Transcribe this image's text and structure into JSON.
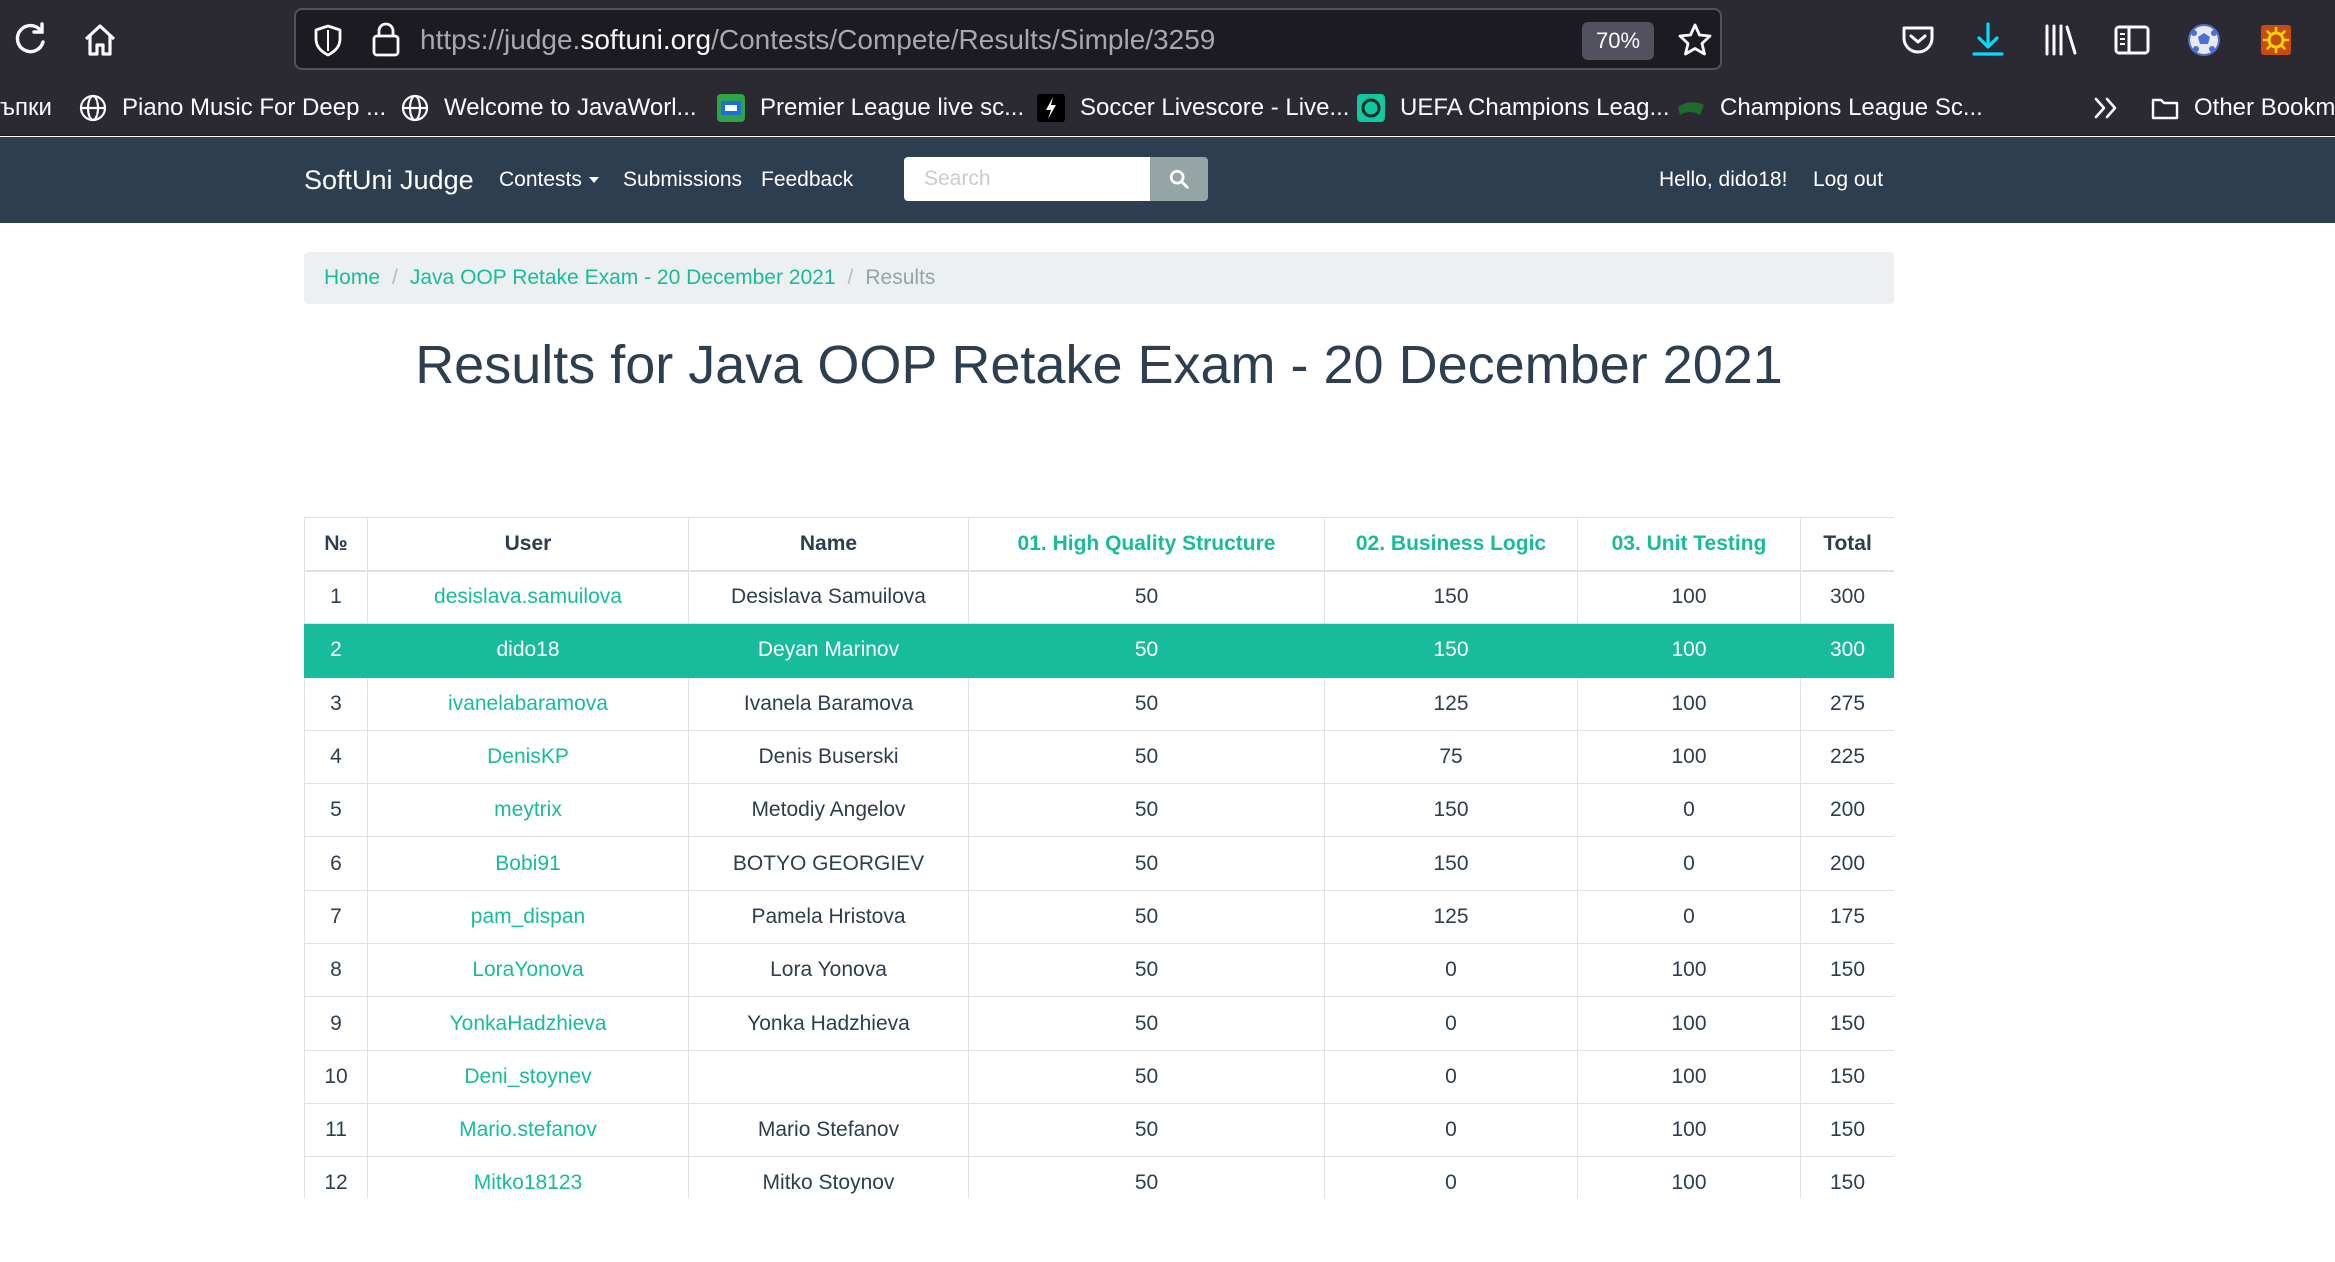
{
  "browser": {
    "url_scheme_path_before": "https://judge.",
    "url_host": "softuni.org",
    "url_path_after": "/Contests/Compete/Results/Simple/3259",
    "zoom": "70%"
  },
  "bookmarks": [
    {
      "label": "ъпки",
      "icon": "folder-icon"
    },
    {
      "label": "Piano Music For Deep ...",
      "icon": "globe-icon"
    },
    {
      "label": "Welcome to JavaWorl...",
      "icon": "globe-icon"
    },
    {
      "label": "Premier League live sc...",
      "icon": "premier-league-icon"
    },
    {
      "label": "Soccer Livescore - Live...",
      "icon": "livescore-icon"
    },
    {
      "label": "UEFA Champions Leag...",
      "icon": "uefa-icon"
    },
    {
      "label": "Champions League Sc...",
      "icon": "champions-league-icon"
    },
    {
      "label": "Other Bookma",
      "icon": "folder-icon"
    }
  ],
  "navbar": {
    "brand": "SoftUni Judge",
    "contests": "Contests",
    "submissions": "Submissions",
    "feedback": "Feedback",
    "search_placeholder": "Search",
    "greeting": "Hello, dido18!",
    "logout": "Log out"
  },
  "breadcrumb": {
    "home": "Home",
    "contest": "Java OOP Retake Exam - 20 December 2021",
    "current": "Results"
  },
  "page_title": "Results for Java OOP Retake Exam - 20 December 2021",
  "table": {
    "headers": [
      "№",
      "User",
      "Name",
      "01. High Quality Structure",
      "02. Business Logic",
      "03. Unit Testing",
      "Total"
    ],
    "rows": [
      {
        "num": "1",
        "user": "desislava.samuilova",
        "name": "Desislava Samuilova",
        "t1": "50",
        "t2": "150",
        "t3": "100",
        "total": "300"
      },
      {
        "num": "2",
        "user": "dido18",
        "name": "Deyan Marinov",
        "t1": "50",
        "t2": "150",
        "t3": "100",
        "total": "300",
        "highlight": true
      },
      {
        "num": "3",
        "user": "ivanelabaramova",
        "name": "Ivanela Baramova",
        "t1": "50",
        "t2": "125",
        "t3": "100",
        "total": "275"
      },
      {
        "num": "4",
        "user": "DenisKP",
        "name": "Denis Buserski",
        "t1": "50",
        "t2": "75",
        "t3": "100",
        "total": "225"
      },
      {
        "num": "5",
        "user": "meytrix",
        "name": "Metodiy Angelov",
        "t1": "50",
        "t2": "150",
        "t3": "0",
        "total": "200"
      },
      {
        "num": "6",
        "user": "Bobi91",
        "name": "BOTYO GEORGIEV",
        "t1": "50",
        "t2": "150",
        "t3": "0",
        "total": "200"
      },
      {
        "num": "7",
        "user": "pam_dispan",
        "name": "Pamela Hristova",
        "t1": "50",
        "t2": "125",
        "t3": "0",
        "total": "175"
      },
      {
        "num": "8",
        "user": "LoraYonova",
        "name": "Lora Yonova",
        "t1": "50",
        "t2": "0",
        "t3": "100",
        "total": "150"
      },
      {
        "num": "9",
        "user": "YonkaHadzhieva",
        "name": "Yonka Hadzhieva",
        "t1": "50",
        "t2": "0",
        "t3": "100",
        "total": "150"
      },
      {
        "num": "10",
        "user": "Deni_stoynev",
        "name": "",
        "t1": "50",
        "t2": "0",
        "t3": "100",
        "total": "150"
      },
      {
        "num": "11",
        "user": "Mario.stefanov",
        "name": "Mario Stefanov",
        "t1": "50",
        "t2": "0",
        "t3": "100",
        "total": "150"
      },
      {
        "num": "12",
        "user": "Mitko18123",
        "name": "Mitko Stoynov",
        "t1": "50",
        "t2": "0",
        "t3": "100",
        "total": "150"
      }
    ]
  },
  "colors": {
    "navbar": "#2c3e50",
    "accent": "#18bc9c",
    "browser_chrome": "#2b2a33"
  }
}
